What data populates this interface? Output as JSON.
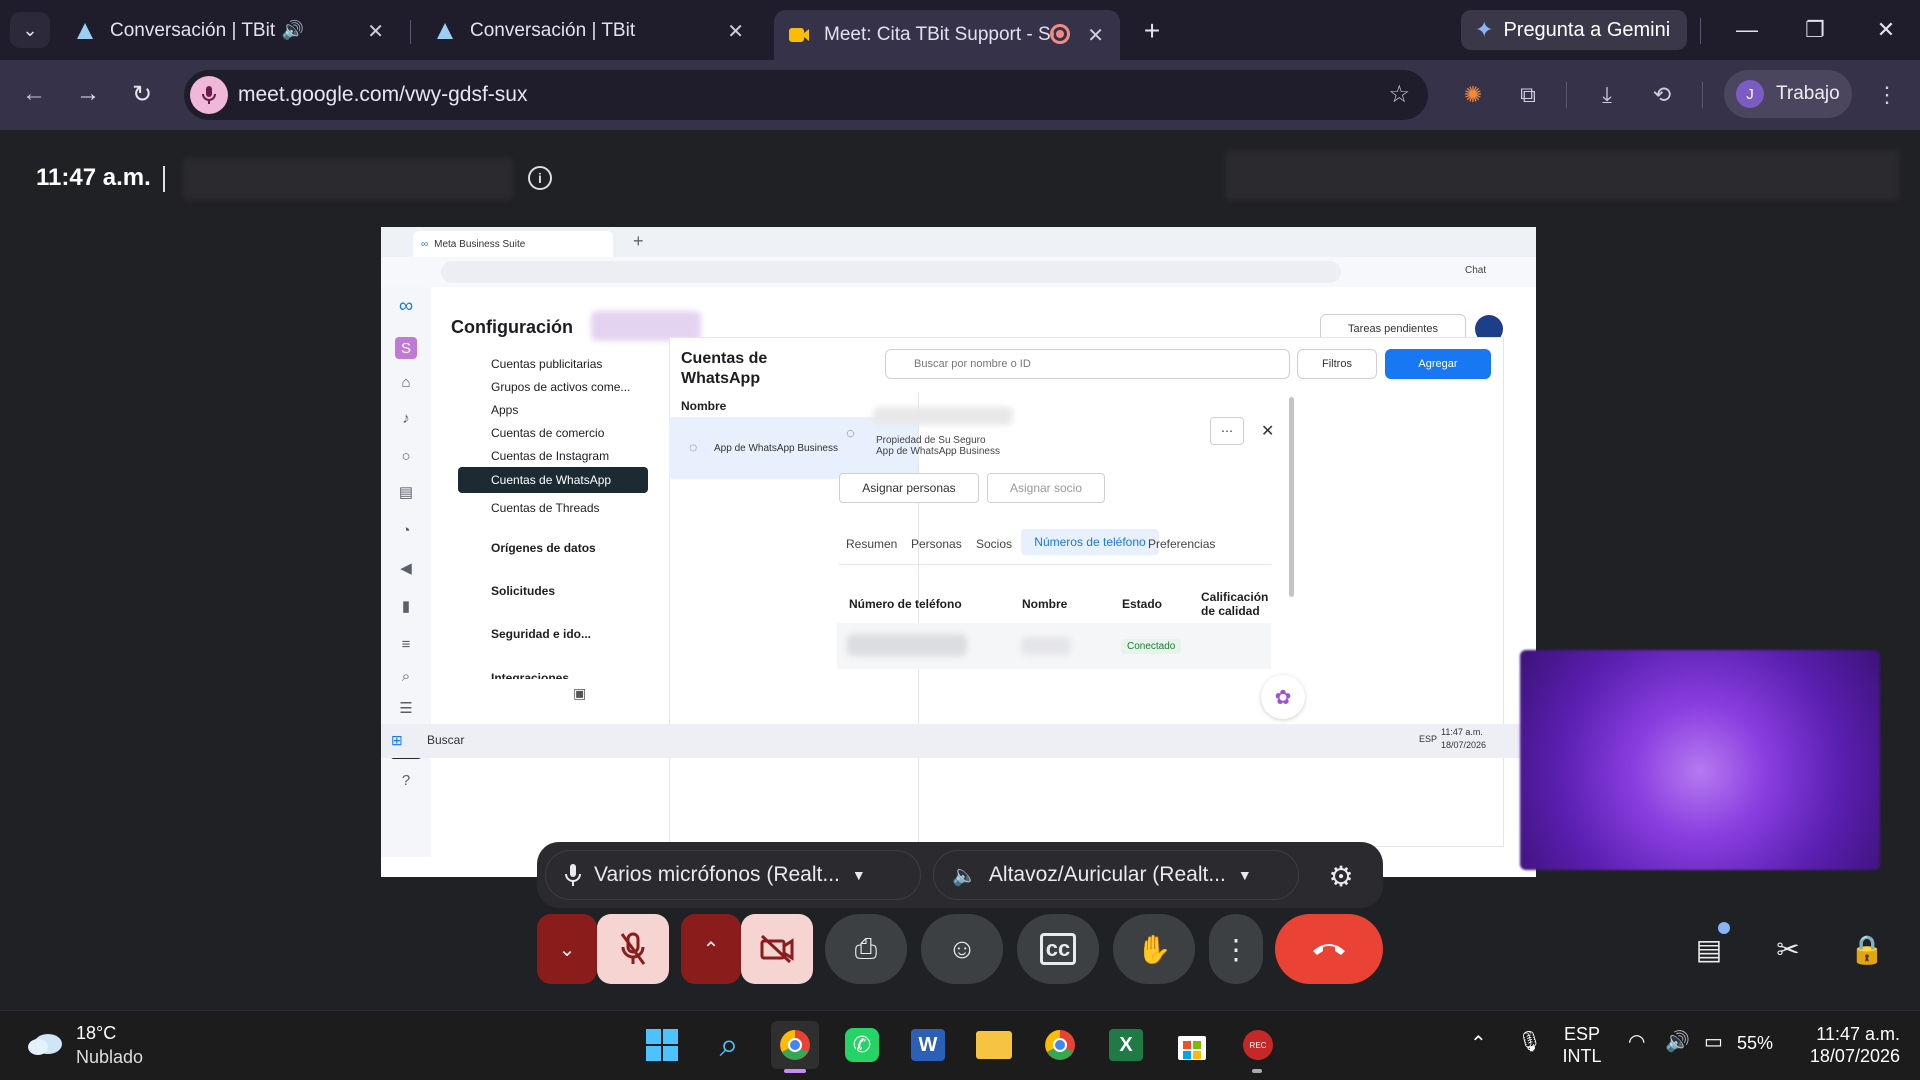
{
  "browser": {
    "tabs": [
      {
        "title": "Conversación | TBit",
        "audio_icon": "speaker-icon"
      },
      {
        "title": "Conversación | TBit"
      },
      {
        "title": "Meet: Cita TBit Support - Su",
        "recording_icon": "record-icon"
      }
    ],
    "gemini_label": "Pregunta a Gemini",
    "url": "meet.google.com/vwy-gdsf-sux",
    "profile_initial": "J",
    "profile_name": "Trabajo"
  },
  "meet": {
    "time": "11:47 a.m.",
    "mic_device": "Varios micrófonos (Realt...",
    "speaker_device": "Altavoz/Auricular (Realt...",
    "colors": {
      "end_call": "#ea4335",
      "muted": "#8a1c1c",
      "muted_bg": "#f5d4d1"
    }
  },
  "presentation": {
    "browser_tab": "Meta Business Suite",
    "chat_label": "Chat",
    "page_title": "Configuración",
    "pending_tasks": "Tareas pendientes",
    "nav_items": [
      "Cuentas publicitarias",
      "Grupos de activos come...",
      "Apps",
      "Cuentas de comercio",
      "Cuentas de Instagram"
    ],
    "nav_active": "Cuentas de WhatsApp",
    "nav_after": "Cuentas de Threads",
    "nav_groups": [
      "Orígenes de datos",
      "Solicitudes",
      "Seguridad e ido...",
      "Integraciones"
    ],
    "section_title": "Cuentas de WhatsApp",
    "search_placeholder": "Buscar por nombre o ID",
    "filters": "Filtros",
    "add": "Agregar",
    "column_name": "Nombre",
    "list_item_sub": "App de WhatsApp Business",
    "detail_owner": "Propiedad de Su Seguro",
    "detail_app": "App de WhatsApp Business",
    "assign_people": "Asignar personas",
    "assign_partner": "Asignar socio",
    "detail_tabs": [
      "Resumen",
      "Personas",
      "Socios"
    ],
    "detail_tab_active": "Números de teléfono",
    "detail_tab_last": "Preferencias",
    "table_headers": [
      "Número de teléfono",
      "Nombre",
      "Estado",
      "Calificación de calidad"
    ],
    "status": "Conectado",
    "taskbar_search": "Buscar",
    "taskbar_lang": "ESP",
    "taskbar_time": "11:47 a.m.",
    "taskbar_date": "18/07/2026"
  },
  "taskbar": {
    "temperature": "18°C",
    "weather": "Nublado",
    "language": "ESP",
    "layout": "INTL",
    "battery": "55%",
    "time": "11:47 a.m.",
    "date": "18/07/2026"
  }
}
